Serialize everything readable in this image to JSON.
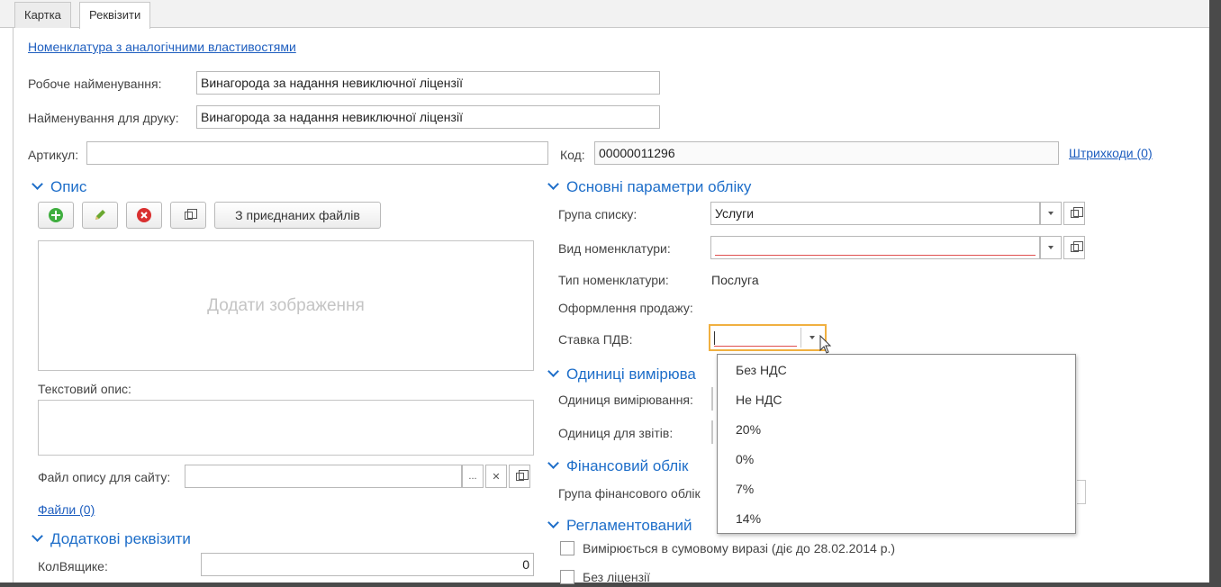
{
  "tabs": [
    "Картка",
    "Реквізити"
  ],
  "similar_link": "Номенклатура з аналогічними властивостями",
  "working_name": {
    "label": "Робоче найменування:",
    "value": "Винагорода за надання невиключної ліцензії"
  },
  "print_name": {
    "label": "Найменування для друку:",
    "value": "Винагорода за надання невиключної ліцензії"
  },
  "article": {
    "label": "Артикул:",
    "value": ""
  },
  "code": {
    "label": "Код:",
    "value": "00000011296"
  },
  "barcodes_link": "Штрихкоди (0)",
  "description": {
    "title": "Опис",
    "attach_button": "З приєднаних файлів",
    "image_placeholder": "Додати зображення",
    "text_label": "Текстовий опис:",
    "site_file_label": "Файл опису для сайту:",
    "files_link": "Файли (0)"
  },
  "extra": {
    "title": "Додаткові реквізити",
    "box_label": "КолВящике:",
    "box_value": "0"
  },
  "accounting": {
    "title": "Основні параметри обліку",
    "group_label": "Група списку:",
    "group_value": "Услуги",
    "kind_label": "Вид номенклатури:",
    "kind_value": "",
    "type_label": "Тип номенклатури:",
    "type_value": "Послуга",
    "sale_label": "Оформлення продажу:",
    "vat_label": "Ставка ПДВ:",
    "vat_value": ""
  },
  "units": {
    "title": "Одиниці вимірюва",
    "unit_label": "Одиниця вимірювання:",
    "report_label": "Одиниця для звітів:"
  },
  "finance": {
    "title": "Фінансовий облік",
    "group_label": "Група фінансового облік"
  },
  "regulated": {
    "title": "Регламентований",
    "measured_label": "Вимірюється в сумовому виразі (діє до 28.02.2014 р.)",
    "no_license_label": "Без ліцензії"
  },
  "vat_options": [
    "Без НДС",
    "Не НДС",
    "20%",
    "0%",
    "7%",
    "14%"
  ],
  "colors": {
    "accent": "#1e6ec9",
    "link": "#1e5ebf",
    "focus": "#f0b040",
    "error": "#e05050"
  },
  "icons": [
    "add-icon",
    "edit-icon",
    "delete-icon",
    "copy-icon",
    "chevron-down-icon",
    "clear-icon",
    "more-icon",
    "cursor-icon"
  ]
}
